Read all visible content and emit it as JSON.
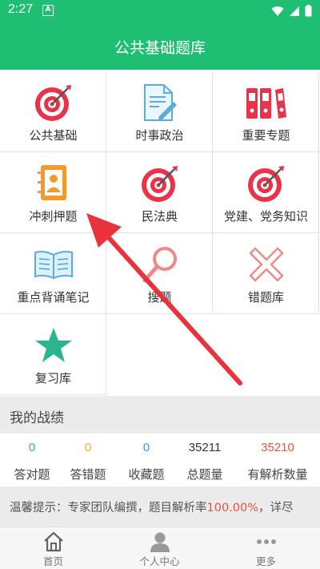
{
  "status": {
    "time": "2:27",
    "a_badge": "A"
  },
  "header": {
    "title": "公共基础题库"
  },
  "grid": [
    {
      "label": "公共基础",
      "icon": "target-icon"
    },
    {
      "label": "时事政治",
      "icon": "document-pen-icon"
    },
    {
      "label": "重要专题",
      "icon": "binders-icon"
    },
    {
      "label": "冲刺押题",
      "icon": "contact-book-icon"
    },
    {
      "label": "民法典",
      "icon": "target-icon"
    },
    {
      "label": "党建、党务知识",
      "icon": "target-icon"
    },
    {
      "label": "重点背诵笔记",
      "icon": "open-book-icon"
    },
    {
      "label": "搜题",
      "icon": "magnifier-icon"
    },
    {
      "label": "错题库",
      "icon": "x-mark-icon"
    },
    {
      "label": "复习库",
      "icon": "star-icon"
    }
  ],
  "stats": {
    "title": "我的战绩",
    "items": [
      {
        "value": "0",
        "label": "答对题",
        "color": "#3aa0d8"
      },
      {
        "value": "0",
        "label": "答错题",
        "color": "#f0b030"
      },
      {
        "value": "0",
        "label": "收藏题",
        "color": "#3aa0d8"
      },
      {
        "value": "35211",
        "label": "总题量",
        "color": "#333333"
      },
      {
        "value": "35210",
        "label": "有解析数量",
        "color": "#e8533f"
      }
    ]
  },
  "notice": {
    "prefix": "温馨提示：专家团队编撰，题目解析率",
    "rate": "100.00%",
    "suffix": "，详尽"
  },
  "nav": [
    {
      "label": "首页",
      "icon": "home-icon"
    },
    {
      "label": "个人中心",
      "icon": "person-icon"
    },
    {
      "label": "更多",
      "icon": "more-dots-icon"
    }
  ],
  "colors": {
    "brand": "#1fbf73",
    "accent_red": "#e8334a",
    "arrow": "#e8333c"
  }
}
